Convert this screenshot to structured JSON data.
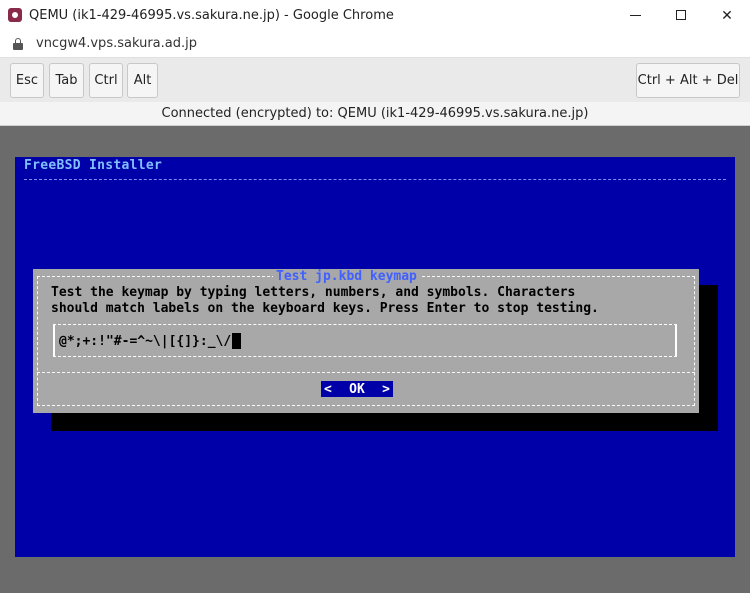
{
  "window": {
    "title": "QEMU (ik1-429-46995.vs.sakura.ne.jp) - Google Chrome",
    "url": "vncgw4.vps.sakura.ad.jp"
  },
  "toolbar": {
    "esc_label": "Esc",
    "tab_label": "Tab",
    "ctrl_label": "Ctrl",
    "alt_label": "Alt",
    "cad_label": "Ctrl + Alt + Del"
  },
  "status": "Connected (encrypted) to: QEMU (ik1-429-46995.vs.sakura.ne.jp)",
  "installer": {
    "title": "FreeBSD Installer",
    "dialog": {
      "title": "Test jp.kbd keymap",
      "line1": "Test the keymap by typing letters, numbers, and symbols. Characters",
      "line2": "should match labels on the keyboard keys. Press Enter to stop testing.",
      "input_value": "@*;+:!\"#-=^~\\|[{]}:_\\/",
      "ok_left": "<",
      "ok_label": "OK",
      "ok_right": ">"
    }
  },
  "colors": {
    "vnc_background": "#0000a8",
    "dialog_background": "#a8a8a8",
    "dialog_title": "#4060ff",
    "installer_title": "#80c0ff"
  }
}
